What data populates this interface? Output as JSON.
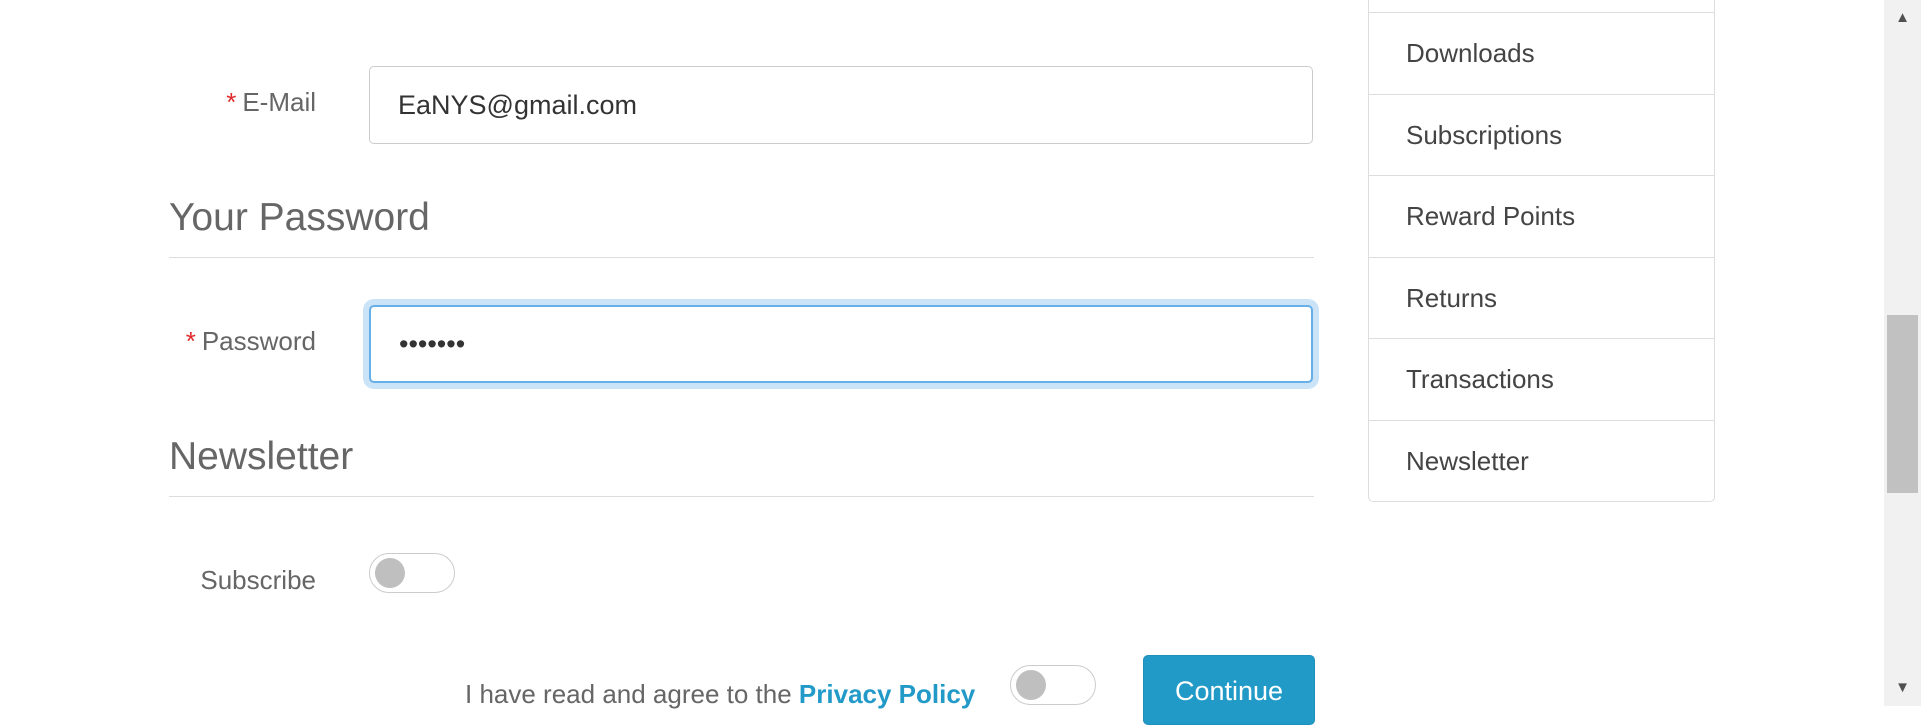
{
  "form": {
    "email": {
      "label": "E-Mail",
      "required_mark": "*",
      "value": "EaNYS@gmail.com"
    },
    "password_section": {
      "title": "Your Password"
    },
    "password": {
      "label": "Password",
      "required_mark": "*",
      "value": "•••••••"
    },
    "newsletter_section": {
      "title": "Newsletter"
    },
    "subscribe": {
      "label": "Subscribe",
      "checked": false
    },
    "agree": {
      "text": "I have read and agree to the ",
      "link_text": "Privacy Policy",
      "checked": false
    },
    "continue_label": "Continue"
  },
  "sidebar": {
    "items": [
      {
        "label": ""
      },
      {
        "label": "Downloads"
      },
      {
        "label": "Subscriptions"
      },
      {
        "label": "Reward Points"
      },
      {
        "label": "Returns"
      },
      {
        "label": "Transactions"
      },
      {
        "label": "Newsletter"
      }
    ]
  },
  "scrollbar": {
    "up_icon": "triangle-up",
    "down_icon": "triangle-down"
  },
  "colors": {
    "accent": "#229ac8",
    "required": "#e0292b",
    "focus": "#66afe9"
  }
}
